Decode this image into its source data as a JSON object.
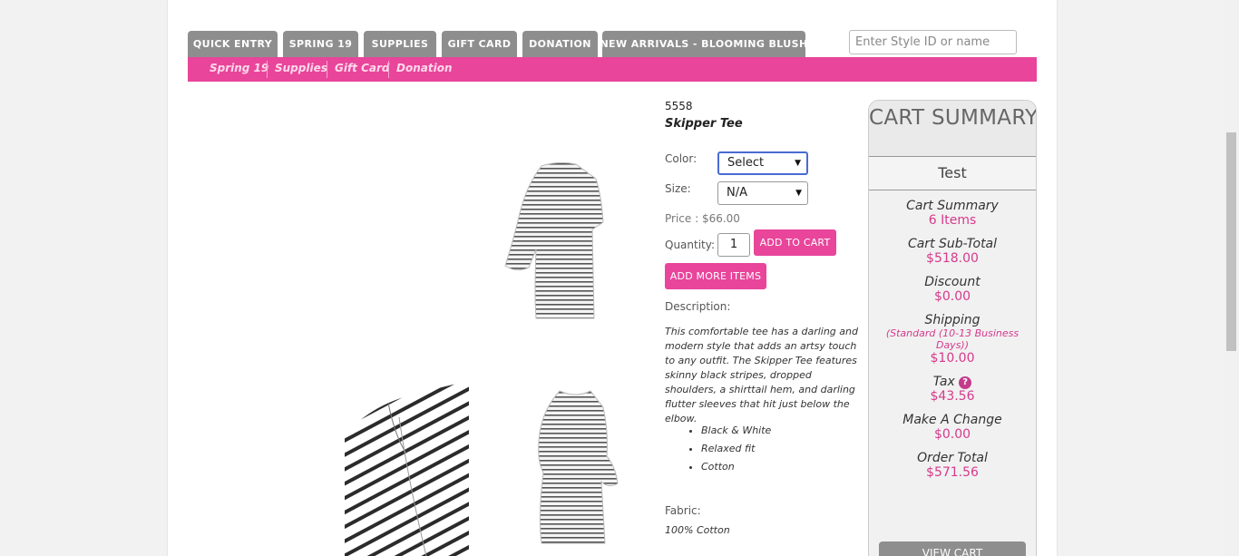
{
  "tabs": [
    "QUICK ENTRY",
    "SPRING 19",
    "SUPPLIES",
    "GIFT CARD",
    "DONATION",
    "NEW ARRIVALS - BLOOMING BLUSH"
  ],
  "search": {
    "placeholder": "Enter Style ID or name"
  },
  "subnav": [
    "Spring 19",
    "Supplies",
    "Gift Card",
    "Donation"
  ],
  "product": {
    "style_id": "5558",
    "name": "Skipper Tee",
    "color_label": "Color:",
    "color_value": "Select",
    "size_label": "Size:",
    "size_value": "N/A",
    "price": "Price : $66.00",
    "quantity_label": "Quantity:",
    "quantity_value": "1",
    "add_to_cart": "ADD TO CART",
    "add_more": "ADD MORE ITEMS",
    "description_label": "Description:",
    "description": "This comfortable tee has a darling and modern style that adds an artsy touch to any outfit. The Skipper Tee features skinny black stripes, dropped shoulders, a shirttail hem, and darling flutter sleeves that hit just below the elbow.",
    "features": [
      "Black & White",
      "Relaxed fit",
      "Cotton"
    ],
    "fabric_label": "Fabric:",
    "fabric": "100% Cotton"
  },
  "cart": {
    "title": "CART SUMMARY",
    "user": "Test",
    "summary_label": "Cart Summary",
    "items": "6 Items",
    "subtotal_label": "Cart Sub-Total",
    "subtotal": "$518.00",
    "discount_label": "Discount",
    "discount": "$0.00",
    "shipping_label": "Shipping",
    "shipping_method": "(Standard (10-13 Business Days))",
    "shipping": "$10.00",
    "tax_label": "Tax",
    "tax": "$43.56",
    "change_label": "Make A Change",
    "change": "$0.00",
    "total_label": "Order Total",
    "total": "$571.56",
    "view_cart": "VIEW CART"
  },
  "colors": {
    "accent": "#e8459b",
    "tab": "#8e8e8e"
  }
}
